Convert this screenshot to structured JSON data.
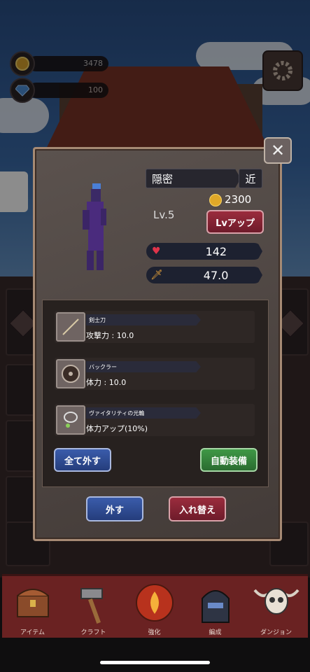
{
  "currency": {
    "gold": "3478",
    "gems": "100"
  },
  "character": {
    "name": "隠密",
    "range": "近",
    "level": "Lv.5",
    "upgrade_cost": "2300",
    "upgrade_label": "Lvアップ",
    "hp": "142",
    "attack": "47.0"
  },
  "equipment": [
    {
      "name": "剣士刀",
      "stat": "攻撃力 : 10.0",
      "icon": "katana-icon"
    },
    {
      "name": "バックラー",
      "stat": "体力 : 10.0",
      "icon": "shield-icon"
    },
    {
      "name": "ヴァイタリティの光輪",
      "stat": "体力アップ(10%)",
      "icon": "necklace-icon"
    }
  ],
  "buttons": {
    "unequip_all": "全て外す",
    "auto_equip": "自動装備",
    "remove": "外す",
    "swap": "入れ替え"
  },
  "nav": [
    {
      "label": "アイテム",
      "icon": "chest-icon"
    },
    {
      "label": "クラフト",
      "icon": "hammer-icon"
    },
    {
      "label": "強化",
      "icon": "fire-orb-icon"
    },
    {
      "label": "編成",
      "icon": "helmet-icon"
    },
    {
      "label": "ダンジョン",
      "icon": "skull-icon"
    }
  ]
}
